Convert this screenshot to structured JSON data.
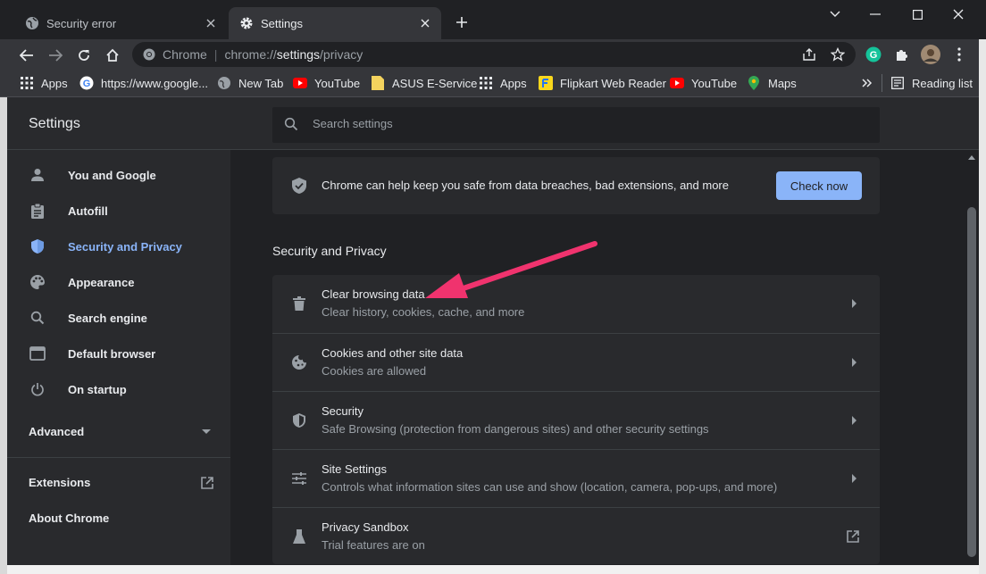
{
  "tabs": [
    {
      "title": "Security error",
      "icon": "globe-icon"
    },
    {
      "title": "Settings",
      "icon": "gear-icon"
    }
  ],
  "omnibox": {
    "site_label": "Chrome",
    "url_prefix": "chrome://",
    "url_host": "settings",
    "url_path": "/privacy"
  },
  "bookmarks": [
    {
      "label": "Apps",
      "icon": "apps-grid-icon"
    },
    {
      "label": "https://www.google...",
      "icon": "google-icon"
    },
    {
      "label": "New Tab",
      "icon": "globe-icon"
    },
    {
      "label": "YouTube",
      "icon": "youtube-icon"
    },
    {
      "label": "ASUS E-Service",
      "icon": "folder-icon"
    },
    {
      "label": "Apps",
      "icon": "apps-grid-icon"
    },
    {
      "label": "Flipkart Web Reader",
      "icon": "flipkart-icon"
    },
    {
      "label": "YouTube",
      "icon": "youtube-icon"
    },
    {
      "label": "Maps",
      "icon": "maps-pin-icon"
    }
  ],
  "reading_list": "Reading list",
  "settings": {
    "title": "Settings",
    "search_placeholder": "Search settings",
    "nav": [
      {
        "label": "You and Google",
        "icon": "person-icon"
      },
      {
        "label": "Autofill",
        "icon": "clipboard-icon"
      },
      {
        "label": "Security and Privacy",
        "icon": "shield-icon",
        "active": true
      },
      {
        "label": "Appearance",
        "icon": "palette-icon"
      },
      {
        "label": "Search engine",
        "icon": "search-icon"
      },
      {
        "label": "Default browser",
        "icon": "browser-icon"
      },
      {
        "label": "On startup",
        "icon": "power-icon"
      }
    ],
    "advanced": "Advanced",
    "extensions": "Extensions",
    "about": "About Chrome",
    "safety_check": {
      "text": "Chrome can help keep you safe from data breaches, bad extensions, and more",
      "button": "Check now"
    },
    "section_title": "Security and Privacy",
    "rows": [
      {
        "title": "Clear browsing data",
        "subtitle": "Clear history, cookies, cache, and more",
        "icon": "trash-icon"
      },
      {
        "title": "Cookies and other site data",
        "subtitle": "Cookies are allowed",
        "icon": "cookie-icon"
      },
      {
        "title": "Security",
        "subtitle": "Safe Browsing (protection from dangerous sites) and other security settings",
        "icon": "shield-icon"
      },
      {
        "title": "Site Settings",
        "subtitle": "Controls what information sites can use and show (location, camera, pop-ups, and more)",
        "icon": "sliders-icon"
      },
      {
        "title": "Privacy Sandbox",
        "subtitle": "Trial features are on",
        "icon": "flask-icon"
      }
    ]
  },
  "colors": {
    "accent": "#8ab4f8",
    "annotation_arrow": "#f0336e"
  }
}
